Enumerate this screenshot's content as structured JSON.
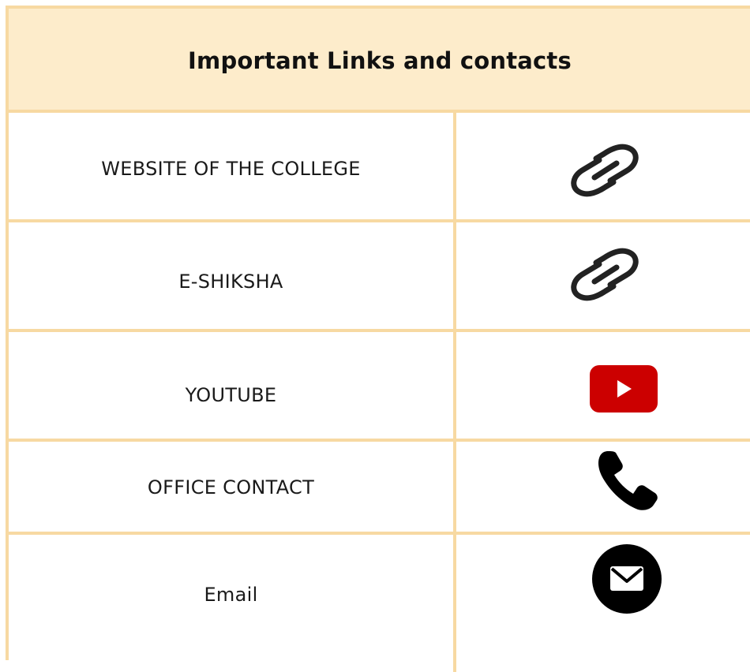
{
  "header": {
    "title": "Important Links and contacts"
  },
  "rows": [
    {
      "label": "WEBSITE OF THE COLLEGE",
      "icon": "link-icon"
    },
    {
      "label": "E-SHIKSHA",
      "icon": "link-icon"
    },
    {
      "label": "YOUTUBE",
      "icon": "youtube-icon"
    },
    {
      "label": "OFFICE CONTACT",
      "icon": "phone-icon"
    },
    {
      "label": "Email",
      "icon": "email-icon"
    }
  ],
  "colors": {
    "border": "#f7d9a2",
    "header_bg": "#fdeccb",
    "youtube_red": "#cc0000",
    "icon_dark": "#222222"
  }
}
